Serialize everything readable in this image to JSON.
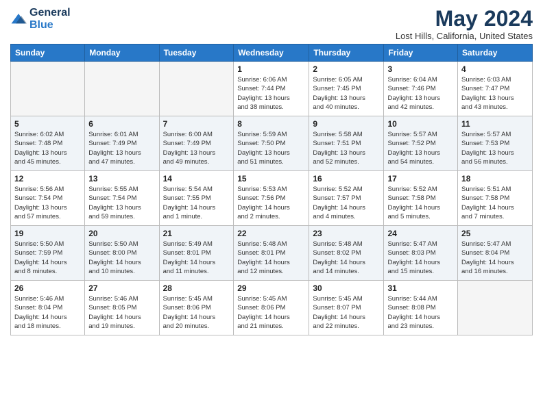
{
  "logo": {
    "line1": "General",
    "line2": "Blue"
  },
  "title": "May 2024",
  "location": "Lost Hills, California, United States",
  "days_header": [
    "Sunday",
    "Monday",
    "Tuesday",
    "Wednesday",
    "Thursday",
    "Friday",
    "Saturday"
  ],
  "weeks": [
    [
      {
        "day": "",
        "info": ""
      },
      {
        "day": "",
        "info": ""
      },
      {
        "day": "",
        "info": ""
      },
      {
        "day": "1",
        "info": "Sunrise: 6:06 AM\nSunset: 7:44 PM\nDaylight: 13 hours\nand 38 minutes."
      },
      {
        "day": "2",
        "info": "Sunrise: 6:05 AM\nSunset: 7:45 PM\nDaylight: 13 hours\nand 40 minutes."
      },
      {
        "day": "3",
        "info": "Sunrise: 6:04 AM\nSunset: 7:46 PM\nDaylight: 13 hours\nand 42 minutes."
      },
      {
        "day": "4",
        "info": "Sunrise: 6:03 AM\nSunset: 7:47 PM\nDaylight: 13 hours\nand 43 minutes."
      }
    ],
    [
      {
        "day": "5",
        "info": "Sunrise: 6:02 AM\nSunset: 7:48 PM\nDaylight: 13 hours\nand 45 minutes."
      },
      {
        "day": "6",
        "info": "Sunrise: 6:01 AM\nSunset: 7:49 PM\nDaylight: 13 hours\nand 47 minutes."
      },
      {
        "day": "7",
        "info": "Sunrise: 6:00 AM\nSunset: 7:49 PM\nDaylight: 13 hours\nand 49 minutes."
      },
      {
        "day": "8",
        "info": "Sunrise: 5:59 AM\nSunset: 7:50 PM\nDaylight: 13 hours\nand 51 minutes."
      },
      {
        "day": "9",
        "info": "Sunrise: 5:58 AM\nSunset: 7:51 PM\nDaylight: 13 hours\nand 52 minutes."
      },
      {
        "day": "10",
        "info": "Sunrise: 5:57 AM\nSunset: 7:52 PM\nDaylight: 13 hours\nand 54 minutes."
      },
      {
        "day": "11",
        "info": "Sunrise: 5:57 AM\nSunset: 7:53 PM\nDaylight: 13 hours\nand 56 minutes."
      }
    ],
    [
      {
        "day": "12",
        "info": "Sunrise: 5:56 AM\nSunset: 7:54 PM\nDaylight: 13 hours\nand 57 minutes."
      },
      {
        "day": "13",
        "info": "Sunrise: 5:55 AM\nSunset: 7:54 PM\nDaylight: 13 hours\nand 59 minutes."
      },
      {
        "day": "14",
        "info": "Sunrise: 5:54 AM\nSunset: 7:55 PM\nDaylight: 14 hours\nand 1 minute."
      },
      {
        "day": "15",
        "info": "Sunrise: 5:53 AM\nSunset: 7:56 PM\nDaylight: 14 hours\nand 2 minutes."
      },
      {
        "day": "16",
        "info": "Sunrise: 5:52 AM\nSunset: 7:57 PM\nDaylight: 14 hours\nand 4 minutes."
      },
      {
        "day": "17",
        "info": "Sunrise: 5:52 AM\nSunset: 7:58 PM\nDaylight: 14 hours\nand 5 minutes."
      },
      {
        "day": "18",
        "info": "Sunrise: 5:51 AM\nSunset: 7:58 PM\nDaylight: 14 hours\nand 7 minutes."
      }
    ],
    [
      {
        "day": "19",
        "info": "Sunrise: 5:50 AM\nSunset: 7:59 PM\nDaylight: 14 hours\nand 8 minutes."
      },
      {
        "day": "20",
        "info": "Sunrise: 5:50 AM\nSunset: 8:00 PM\nDaylight: 14 hours\nand 10 minutes."
      },
      {
        "day": "21",
        "info": "Sunrise: 5:49 AM\nSunset: 8:01 PM\nDaylight: 14 hours\nand 11 minutes."
      },
      {
        "day": "22",
        "info": "Sunrise: 5:48 AM\nSunset: 8:01 PM\nDaylight: 14 hours\nand 12 minutes."
      },
      {
        "day": "23",
        "info": "Sunrise: 5:48 AM\nSunset: 8:02 PM\nDaylight: 14 hours\nand 14 minutes."
      },
      {
        "day": "24",
        "info": "Sunrise: 5:47 AM\nSunset: 8:03 PM\nDaylight: 14 hours\nand 15 minutes."
      },
      {
        "day": "25",
        "info": "Sunrise: 5:47 AM\nSunset: 8:04 PM\nDaylight: 14 hours\nand 16 minutes."
      }
    ],
    [
      {
        "day": "26",
        "info": "Sunrise: 5:46 AM\nSunset: 8:04 PM\nDaylight: 14 hours\nand 18 minutes."
      },
      {
        "day": "27",
        "info": "Sunrise: 5:46 AM\nSunset: 8:05 PM\nDaylight: 14 hours\nand 19 minutes."
      },
      {
        "day": "28",
        "info": "Sunrise: 5:45 AM\nSunset: 8:06 PM\nDaylight: 14 hours\nand 20 minutes."
      },
      {
        "day": "29",
        "info": "Sunrise: 5:45 AM\nSunset: 8:06 PM\nDaylight: 14 hours\nand 21 minutes."
      },
      {
        "day": "30",
        "info": "Sunrise: 5:45 AM\nSunset: 8:07 PM\nDaylight: 14 hours\nand 22 minutes."
      },
      {
        "day": "31",
        "info": "Sunrise: 5:44 AM\nSunset: 8:08 PM\nDaylight: 14 hours\nand 23 minutes."
      },
      {
        "day": "",
        "info": ""
      }
    ]
  ]
}
